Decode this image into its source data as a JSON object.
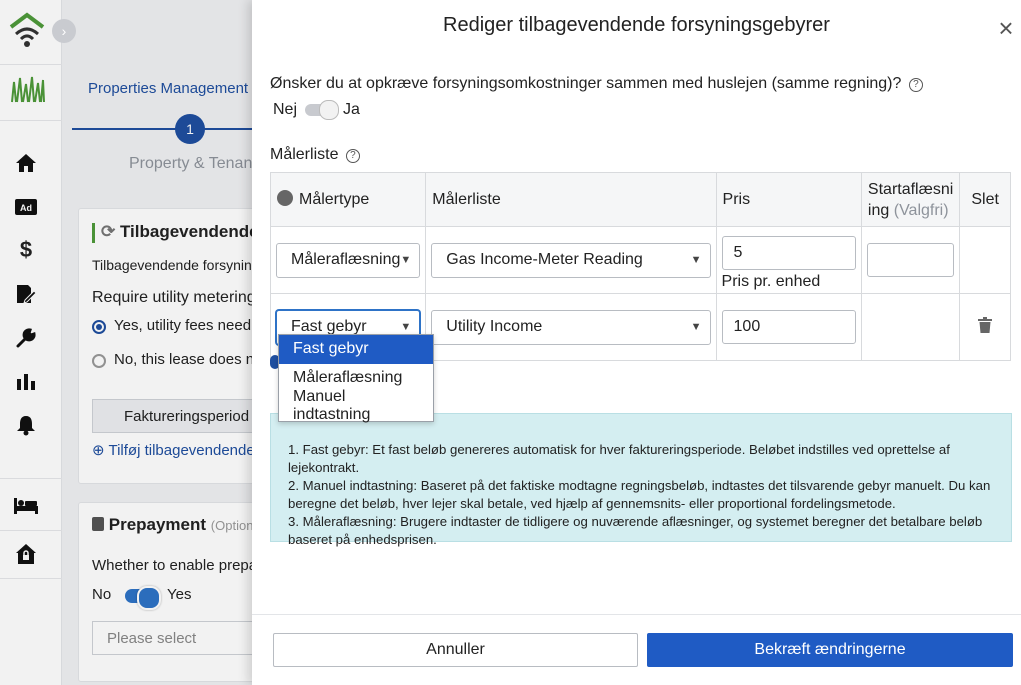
{
  "colors": {
    "primary": "#1f5bc4",
    "brand_green": "#4f9a3a",
    "info_bg": "#d4eef1"
  },
  "sidebar": {
    "logo": "wifi-house-logo-icon",
    "items": [
      "home-icon",
      "ad-icon",
      "dollar-icon",
      "document-edit-icon",
      "wrench-icon",
      "bar-chart-icon",
      "bell-icon",
      "bed-icon",
      "house-lock-icon"
    ]
  },
  "background": {
    "tab_label": "Properties Management (W",
    "step_number": "1",
    "step_label": "Property & Tenant",
    "card1": {
      "title": "Tilbagevendende",
      "subtitle": "Tilbagevendende forsyning",
      "require_label": "Require utility metering",
      "option_yes": "Yes, utility fees need t",
      "option_no": "No, this lease does no",
      "button_label": "Faktureringsperiod",
      "add_link": "Tilføj tilbagevendende"
    },
    "card2": {
      "title": "Prepayment",
      "title_note": "(Option",
      "question": "Whether to enable prepa",
      "toggle_no": "No",
      "toggle_yes": "Yes",
      "select_placeholder": "Please select"
    }
  },
  "drawer": {
    "title": "Rediger tilbagevendende forsyningsgebyrer",
    "question": "Ønsker du at opkræve forsyningsomkostninger sammen med huslejen (samme regning)?",
    "toggle_no": "Nej",
    "toggle_yes": "Ja",
    "meter_list_label": "Målerliste",
    "table": {
      "headers": {
        "type": "Målertype",
        "list": "Målerliste",
        "price": "Pris",
        "start_line1": "Startaflæsni",
        "start_line2": "ing",
        "start_optional": "(Valgfri)",
        "delete": "Slet"
      },
      "rows": [
        {
          "type": "Måleraflæsning",
          "list": "Gas Income-Meter Reading",
          "price": "5",
          "price_unit": "Pris pr. enhed",
          "start": ""
        },
        {
          "type": "Fast gebyr",
          "list": "Utility Income",
          "price": "100"
        }
      ]
    },
    "dropdown_options": [
      "Fast gebyr",
      "Måleraflæsning",
      "Manuel indtastning"
    ],
    "info": [
      "1. Fast gebyr: Et fast beløb genereres automatisk for hver faktureringsperiode. Beløbet indstilles ved oprettelse af lejekontrakt.",
      "2. Manuel indtastning: Baseret på det faktiske modtagne regningsbeløb, indtastes det tilsvarende gebyr manuelt. Du kan beregne det beløb, hver lejer skal betale, ved hjælp af gennemsnits- eller proportional fordelingsmetode.",
      "3. Måleraflæsning: Brugere indtaster de tidligere og nuværende aflæsninger, og systemet beregner det betalbare beløb baseret på enhedsprisen."
    ],
    "cancel_label": "Annuller",
    "confirm_label": "Bekræft ændringerne"
  }
}
